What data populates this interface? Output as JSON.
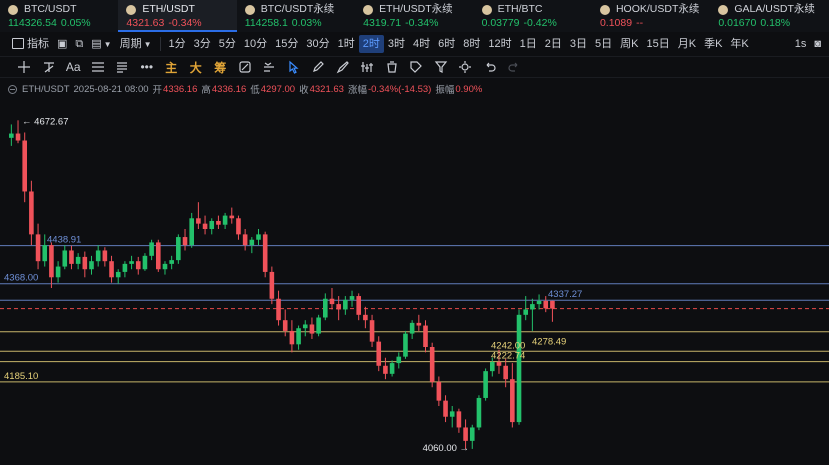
{
  "tickers": [
    {
      "symbol": "BTC/USDT",
      "price": "114326.54",
      "change": "0.05%",
      "dir": "up",
      "active": false,
      "dot": false
    },
    {
      "symbol": "ETH/USDT",
      "price": "4321.63",
      "change": "-0.34%",
      "dir": "down",
      "active": true,
      "dot": true
    },
    {
      "symbol": "BTC/USDT永续",
      "price": "114258.1",
      "change": "0.03%",
      "dir": "up",
      "active": false,
      "dot": false
    },
    {
      "symbol": "ETH/USDT永续",
      "price": "4319.71",
      "change": "-0.34%",
      "dir": "up",
      "active": false,
      "dot": false
    },
    {
      "symbol": "ETH/BTC",
      "price": "0.03779",
      "change": "-0.42%",
      "dir": "up",
      "active": false,
      "dot": false
    },
    {
      "symbol": "HOOK/USDT永续",
      "price": "0.1089",
      "change": "--",
      "dir": "down",
      "active": false,
      "dot": false
    },
    {
      "symbol": "GALA/USDT永续",
      "price": "0.01670",
      "change": "0.18%",
      "dir": "up",
      "active": false,
      "dot": false
    }
  ],
  "toolbar": {
    "indicator_label": "指标",
    "period_label": "周期",
    "intervals": [
      "1分",
      "3分",
      "5分",
      "10分",
      "15分",
      "30分",
      "1时",
      "2时",
      "3时",
      "4时",
      "6时",
      "8时",
      "12时",
      "1日",
      "2日",
      "3日",
      "5日",
      "周K",
      "15日",
      "月K",
      "季K",
      "年K"
    ],
    "active_interval": "2时",
    "right_label": "1s"
  },
  "drawing_tools": {
    "cn_tools": [
      "主",
      "大",
      "筹"
    ]
  },
  "info": {
    "pair": "ETH/USDT",
    "datetime": "2025-08-21 08:00",
    "open_label": "开",
    "open": "4336.16",
    "high_label": "高",
    "high": "4336.16",
    "low_label": "低",
    "low": "4297.00",
    "close_label": "收",
    "close": "4321.63",
    "change_label": "涨幅",
    "change": "-0.34%(-14.53)",
    "amp_label": "振幅",
    "amp": "0.90%"
  },
  "colors": {
    "up": "#23c16b",
    "down": "#f0525a",
    "accent": "#2b6de6",
    "blue_line": "#6f90d8",
    "yellow_line": "#e7d27a",
    "dashed_red": "#e64a4a"
  },
  "chart_data": {
    "type": "candlestick",
    "ylim": [
      4030,
      4718
    ],
    "marked_high": "4672.67",
    "marked_low": "4060.00",
    "horizontal_lines": [
      {
        "price": 4438.91,
        "label": "4438.91",
        "color": "blue"
      },
      {
        "price": 4368.0,
        "label": "4368.00",
        "color": "blue"
      },
      {
        "price": 4337.27,
        "label": "4337.27",
        "color": "blue"
      },
      {
        "price": 4278.49,
        "label": "4278.49",
        "color": "yellow"
      },
      {
        "price": 4242.0,
        "label": "4242.00",
        "color": "yellow"
      },
      {
        "price": 4222.74,
        "label": "4222.74",
        "color": "yellow"
      },
      {
        "price": 4185.1,
        "label": "4185.10",
        "color": "yellow"
      }
    ],
    "current_price": 4321.63,
    "candles": [
      [
        4640,
        4665,
        4625,
        4648
      ],
      [
        4648,
        4672.67,
        4630,
        4635
      ],
      [
        4635,
        4650,
        4520,
        4540
      ],
      [
        4540,
        4560,
        4440,
        4460
      ],
      [
        4460,
        4480,
        4395,
        4410
      ],
      [
        4410,
        4460,
        4400,
        4440
      ],
      [
        4440,
        4445,
        4360,
        4380
      ],
      [
        4380,
        4410,
        4370,
        4400
      ],
      [
        4400,
        4440,
        4395,
        4430
      ],
      [
        4430,
        4438.91,
        4395,
        4405
      ],
      [
        4405,
        4425,
        4395,
        4418
      ],
      [
        4418,
        4428,
        4380,
        4395
      ],
      [
        4395,
        4420,
        4385,
        4410
      ],
      [
        4410,
        4440,
        4400,
        4430
      ],
      [
        4430,
        4436,
        4400,
        4410
      ],
      [
        4410,
        4420,
        4370,
        4380
      ],
      [
        4380,
        4395,
        4368,
        4390
      ],
      [
        4390,
        4410,
        4380,
        4405
      ],
      [
        4405,
        4420,
        4395,
        4410
      ],
      [
        4410,
        4418,
        4385,
        4395
      ],
      [
        4395,
        4425,
        4392,
        4420
      ],
      [
        4420,
        4450,
        4412,
        4445
      ],
      [
        4445,
        4450,
        4390,
        4395
      ],
      [
        4395,
        4410,
        4385,
        4405
      ],
      [
        4405,
        4420,
        4395,
        4412
      ],
      [
        4412,
        4460,
        4405,
        4455
      ],
      [
        4455,
        4470,
        4430,
        4440
      ],
      [
        4440,
        4500,
        4435,
        4490
      ],
      [
        4490,
        4520,
        4470,
        4480
      ],
      [
        4480,
        4495,
        4460,
        4470
      ],
      [
        4470,
        4490,
        4460,
        4485
      ],
      [
        4485,
        4495,
        4470,
        4478
      ],
      [
        4478,
        4500,
        4470,
        4495
      ],
      [
        4495,
        4510,
        4480,
        4490
      ],
      [
        4490,
        4495,
        4450,
        4460
      ],
      [
        4460,
        4470,
        4430,
        4440
      ],
      [
        4440,
        4455,
        4425,
        4450
      ],
      [
        4450,
        4470,
        4440,
        4460
      ],
      [
        4460,
        4465,
        4380,
        4390
      ],
      [
        4390,
        4400,
        4330,
        4340
      ],
      [
        4340,
        4355,
        4290,
        4300
      ],
      [
        4300,
        4320,
        4270,
        4280
      ],
      [
        4280,
        4300,
        4240,
        4255
      ],
      [
        4255,
        4290,
        4245,
        4285
      ],
      [
        4285,
        4300,
        4270,
        4292
      ],
      [
        4292,
        4305,
        4265,
        4275
      ],
      [
        4275,
        4310,
        4270,
        4305
      ],
      [
        4305,
        4350,
        4300,
        4340
      ],
      [
        4340,
        4360,
        4320,
        4330
      ],
      [
        4330,
        4345,
        4300,
        4320
      ],
      [
        4320,
        4345,
        4310,
        4338
      ],
      [
        4338,
        4355,
        4325,
        4345
      ],
      [
        4345,
        4350,
        4300,
        4310
      ],
      [
        4310,
        4325,
        4285,
        4300
      ],
      [
        4300,
        4310,
        4250,
        4260
      ],
      [
        4260,
        4270,
        4205,
        4215
      ],
      [
        4215,
        4230,
        4190,
        4200
      ],
      [
        4200,
        4225,
        4195,
        4220
      ],
      [
        4220,
        4240,
        4210,
        4232
      ],
      [
        4232,
        4280,
        4228,
        4275
      ],
      [
        4275,
        4300,
        4265,
        4295
      ],
      [
        4295,
        4310,
        4280,
        4290
      ],
      [
        4290,
        4300,
        4240,
        4250
      ],
      [
        4250,
        4258,
        4175,
        4185
      ],
      [
        4185,
        4195,
        4140,
        4150
      ],
      [
        4150,
        4160,
        4110,
        4120
      ],
      [
        4120,
        4140,
        4100,
        4130
      ],
      [
        4130,
        4135,
        4090,
        4100
      ],
      [
        4100,
        4115,
        4060,
        4075
      ],
      [
        4075,
        4105,
        4060,
        4100
      ],
      [
        4100,
        4160,
        4095,
        4155
      ],
      [
        4155,
        4210,
        4150,
        4205
      ],
      [
        4205,
        4230,
        4195,
        4222
      ],
      [
        4222,
        4245,
        4200,
        4215
      ],
      [
        4215,
        4228,
        4175,
        4190
      ],
      [
        4190,
        4220,
        4100,
        4110
      ],
      [
        4110,
        4320,
        4105,
        4310
      ],
      [
        4310,
        4345,
        4300,
        4320
      ],
      [
        4320,
        4340,
        4280,
        4330
      ],
      [
        4330,
        4348,
        4320,
        4336
      ],
      [
        4336,
        4345,
        4315,
        4322
      ],
      [
        4336.16,
        4336.16,
        4297,
        4321.63
      ]
    ]
  }
}
